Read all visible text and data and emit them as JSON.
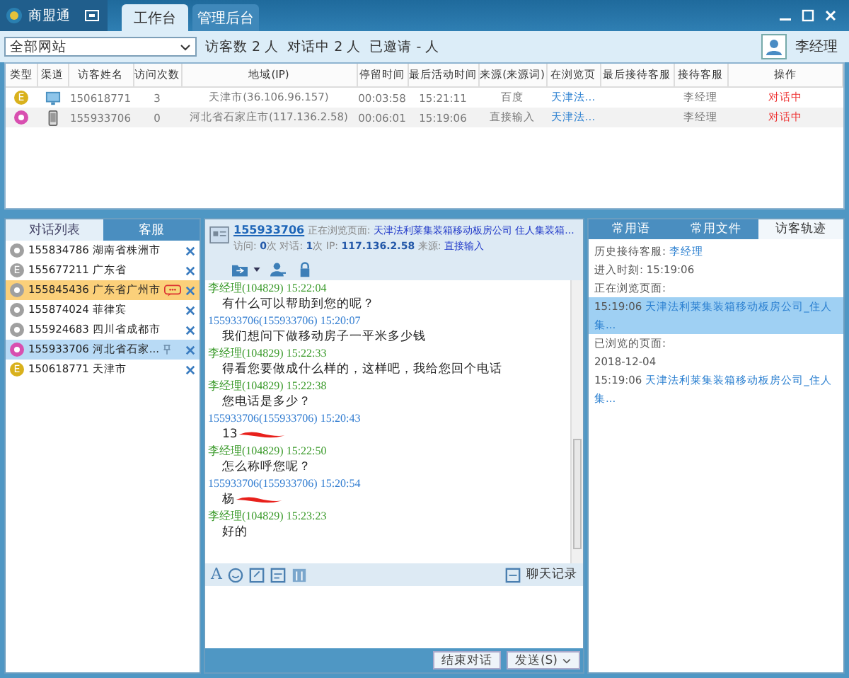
{
  "app": {
    "name": "商盟通"
  },
  "main_tabs": [
    {
      "label": "工作台",
      "selected": true
    },
    {
      "label": "管理后台",
      "selected": false
    }
  ],
  "toolbar": {
    "site_select": "全部网站",
    "visitors": "访客数 2 人",
    "chatting": "对话中 2 人",
    "invited": "已邀请 - 人",
    "user": "李经理"
  },
  "table": {
    "columns": [
      "类型",
      "渠道",
      "访客姓名",
      "访问次数",
      "地域(IP)",
      "停留时间",
      "最后活动时间",
      "来源(来源词)",
      "在浏览页",
      "最后接待客服",
      "接待客服",
      "操作"
    ],
    "rows": [
      {
        "color": "#d9b11c",
        "badge": "E",
        "kind": "pc",
        "name": "150618771",
        "visits": "3",
        "region": "天津市(36.106.96.157)",
        "stay": "00:03:58",
        "last_active": "15:21:11",
        "source": "百度",
        "page": "天津法...",
        "agent": "李经理",
        "status": "对话中"
      },
      {
        "color": "#d84fb0",
        "kind": "mobile",
        "name": "155933706",
        "visits": "0",
        "region": "河北省石家庄市(117.136.2.58)",
        "stay": "00:06:01",
        "last_active": "15:19:06",
        "source": "直接输入",
        "page": "天津法...",
        "agent": "李经理",
        "status": "对话中"
      }
    ]
  },
  "left_tabs": [
    {
      "label": "对话列表",
      "selected": true
    },
    {
      "label": "客服",
      "selected": false
    }
  ],
  "conversations": [
    {
      "id": "155834786",
      "place": "湖南省株洲市",
      "color": "#a0a0a0",
      "selected": false,
      "highlighted": false,
      "new_message": false,
      "pinned": false
    },
    {
      "id": "155677211",
      "place": "广东省",
      "color": "#a0a0a0",
      "badge": "E",
      "selected": false,
      "highlighted": false,
      "new_message": false,
      "pinned": false
    },
    {
      "id": "155845436",
      "place": "广东省广州市",
      "color": "#a0a0a0",
      "selected": false,
      "highlighted": true,
      "new_message": true,
      "pinned": false
    },
    {
      "id": "155874024",
      "place": "菲律宾",
      "color": "#a0a0a0",
      "selected": false,
      "highlighted": false,
      "new_message": false,
      "pinned": false
    },
    {
      "id": "155924683",
      "place": "四川省成都市",
      "color": "#a0a0a0",
      "selected": false,
      "highlighted": false,
      "new_message": false,
      "pinned": false
    },
    {
      "id": "155933706",
      "place": "河北省石家...",
      "color": "#d84fb0",
      "selected": true,
      "highlighted": false,
      "new_message": false,
      "pinned": true
    },
    {
      "id": "150618771",
      "place": "天津市",
      "color": "#d9b11c",
      "badge": "E",
      "selected": false,
      "highlighted": false,
      "new_message": false,
      "pinned": false
    }
  ],
  "chat": {
    "visitor": "155933706",
    "browsing_label": "正在浏览页面:",
    "browsing_page": "天津法利莱集装箱移动板房公司  住人集装箱...",
    "stats_line": "访问: **0**次 对话: **1**次 IP: **117.136.2.58** 来源:",
    "source": "直接输入",
    "messages": [
      {
        "kind": "agent",
        "sender": "李经理",
        "sender_id": "(104829)",
        "time": "15:22:04",
        "text": "有什么可以帮助到您的呢？",
        "redacted": false
      },
      {
        "kind": "visitor",
        "sender": "155933706",
        "sender_id": "(155933706)",
        "time": "15:20:07",
        "text": "我们想问下做移动房子一平米多少钱",
        "redacted": false
      },
      {
        "kind": "agent",
        "sender": "李经理",
        "sender_id": "(104829)",
        "time": "15:22:33",
        "text": "得看您要做成什么样的，这样吧，我给您回个电话",
        "redacted": false
      },
      {
        "kind": "agent",
        "sender": "李经理",
        "sender_id": "(104829)",
        "time": "15:22:38",
        "text": "您电话是多少？",
        "redacted": false
      },
      {
        "kind": "visitor",
        "sender": "155933706",
        "sender_id": "(155933706)",
        "time": "15:20:43",
        "text": "13",
        "redacted": true
      },
      {
        "kind": "agent",
        "sender": "李经理",
        "sender_id": "(104829)",
        "time": "15:22:50",
        "text": "怎么称呼您呢？",
        "redacted": false
      },
      {
        "kind": "visitor",
        "sender": "155933706",
        "sender_id": "(155933706)",
        "time": "15:20:54",
        "text": "杨",
        "redacted": true
      },
      {
        "kind": "agent",
        "sender": "李经理",
        "sender_id": "(104829)",
        "time": "15:23:23",
        "text": "好的",
        "redacted": false
      }
    ],
    "font_button": "A",
    "history_button": "聊天记录",
    "end_button": "结束对话",
    "send_button": "发送(S)"
  },
  "right_tabs": [
    {
      "label": "常用语",
      "selected": false
    },
    {
      "label": "常用文件",
      "selected": false
    },
    {
      "label": "访客轨迹",
      "selected": true
    }
  ],
  "trail": [
    {
      "kind": "pair",
      "label": "历史接待客服:",
      "value": "李经理"
    },
    {
      "kind": "text",
      "text": "进入时刻: 15:19:06"
    },
    {
      "kind": "text",
      "text": "正在浏览页面:"
    },
    {
      "kind": "link",
      "time": "15:19:06",
      "title": "天津法利莱集装箱移动板房公司_住人集...",
      "selected": true
    },
    {
      "kind": "text",
      "text": "已浏览的页面:"
    },
    {
      "kind": "text",
      "text": "2018-12-04"
    },
    {
      "kind": "link",
      "time": "15:19:06",
      "title": "天津法利莱集装箱移动板房公司_住人集...",
      "selected": false
    }
  ]
}
